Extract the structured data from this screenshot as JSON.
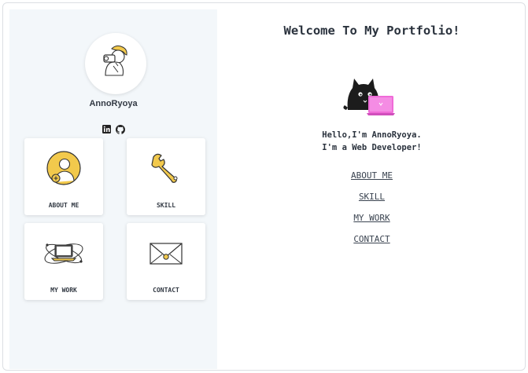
{
  "sidebar": {
    "profile_name": "AnnoRyoya",
    "socials": [
      {
        "icon": "linkedin-icon"
      },
      {
        "icon": "github-icon"
      }
    ],
    "cards": [
      {
        "label": "ABOUT ME",
        "icon": "person-avatar-icon"
      },
      {
        "label": "SKILL",
        "icon": "wrench-icon"
      },
      {
        "label": "MY WORK",
        "icon": "laptop-orbit-icon"
      },
      {
        "label": "CONTACT",
        "icon": "envelope-icon"
      }
    ]
  },
  "main": {
    "title": "Welcome To My Portfolio!",
    "intro_line1": "Hello,I'm AnnoRyoya.",
    "intro_line2": "I'm a Web Developer!",
    "nav": [
      {
        "label": "ABOUT ME"
      },
      {
        "label": "SKILL"
      },
      {
        "label": "MY WORK"
      },
      {
        "label": "CONTACT"
      }
    ]
  },
  "colors": {
    "sidebar_bg": "#f3f7fa",
    "accent_yellow": "#f2c94c",
    "accent_pink": "#f06bd8",
    "text": "#2a323d"
  }
}
